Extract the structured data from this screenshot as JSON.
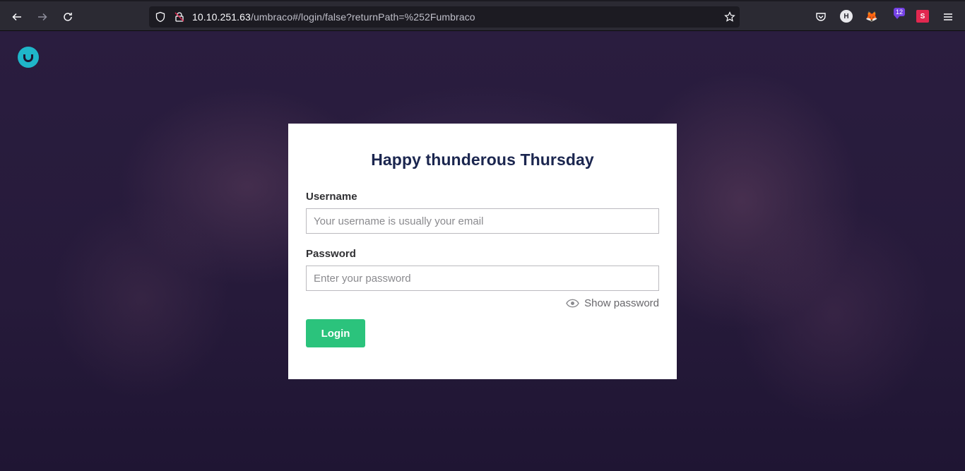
{
  "browser": {
    "url_host": "10.10.251.63",
    "url_path": "/umbraco#/login/false?returnPath=%252Fumbraco",
    "extension_badge": "12",
    "icons": [
      "back-icon",
      "forward-icon",
      "reload-icon",
      "shield-icon",
      "insecure-lock-icon",
      "bookmark-star-icon",
      "pocket-icon",
      "h-extension-icon",
      "fox-extension-icon",
      "download-extension-icon",
      "s-extension-icon",
      "menu-icon"
    ]
  },
  "login": {
    "greeting": "Happy thunderous Thursday",
    "username_label": "Username",
    "username_placeholder": "Your username is usually your email",
    "password_label": "Password",
    "password_placeholder": "Enter your password",
    "show_password": "Show password",
    "login_button": "Login"
  },
  "colors": {
    "brand": "#1fb6c9",
    "login_button": "#2bc37c",
    "background": "#261a3a"
  }
}
